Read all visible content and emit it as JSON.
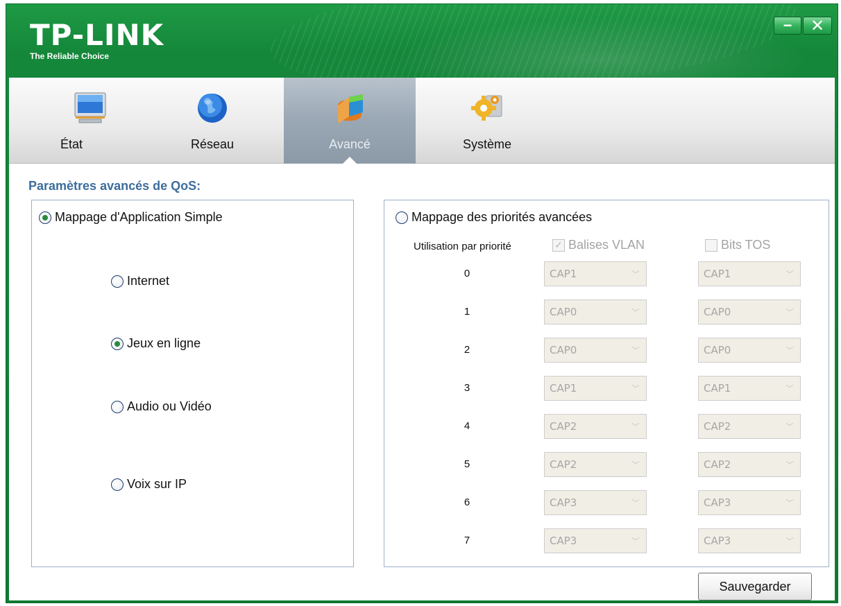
{
  "brand": {
    "name": "TP-LINK",
    "tagline": "The Reliable Choice"
  },
  "window_controls": {
    "minimize": "−",
    "close": "✕"
  },
  "tabs": [
    {
      "label": "État",
      "icon": "monitor-icon"
    },
    {
      "label": "Réseau",
      "icon": "globe-icon"
    },
    {
      "label": "Avancé",
      "icon": "pie-chart-icon",
      "active": true
    },
    {
      "label": "Système",
      "icon": "gears-icon"
    }
  ],
  "section_title": "Paramètres avancés de QoS:",
  "simple_mapping": {
    "label": "Mappage d'Application Simple",
    "selected": true,
    "options": [
      {
        "label": "Internet",
        "selected": false
      },
      {
        "label": "Jeux en ligne",
        "selected": true
      },
      {
        "label": "Audio ou Vidéo",
        "selected": false
      },
      {
        "label": "Voix sur IP",
        "selected": false
      }
    ]
  },
  "advanced_mapping": {
    "label": "Mappage des priorités avancées",
    "selected": false,
    "usage_label": "Utilisation par priorité",
    "vlan_label": "Balises VLAN",
    "vlan_checked": true,
    "tos_label": "Bits TOS",
    "tos_checked": false,
    "rows": [
      {
        "priority": "0",
        "vlan": "CAP1",
        "tos": "CAP1"
      },
      {
        "priority": "1",
        "vlan": "CAP0",
        "tos": "CAP0"
      },
      {
        "priority": "2",
        "vlan": "CAP0",
        "tos": "CAP0"
      },
      {
        "priority": "3",
        "vlan": "CAP1",
        "tos": "CAP1"
      },
      {
        "priority": "4",
        "vlan": "CAP2",
        "tos": "CAP2"
      },
      {
        "priority": "5",
        "vlan": "CAP2",
        "tos": "CAP2"
      },
      {
        "priority": "6",
        "vlan": "CAP3",
        "tos": "CAP3"
      },
      {
        "priority": "7",
        "vlan": "CAP3",
        "tos": "CAP3"
      }
    ]
  },
  "save_label": "Sauvegarder",
  "colors": {
    "brand_green": "#15873a",
    "section_title": "#3c6d9c",
    "radio_dot": "#2a8a3c"
  }
}
